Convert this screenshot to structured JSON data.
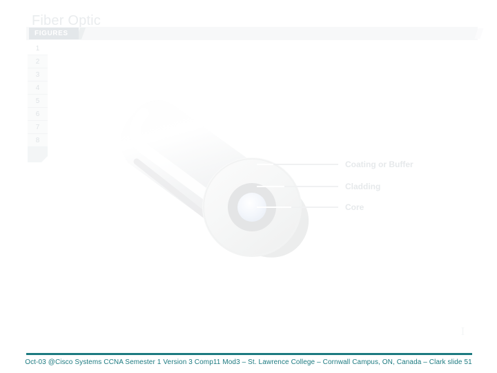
{
  "slide": {
    "title": "Fiber Optic",
    "tab_label": "FIGURES",
    "caret_glyph": "I"
  },
  "figure_rail": {
    "items": [
      "1",
      "2",
      "3",
      "4",
      "5",
      "6",
      "7",
      "8"
    ],
    "blank_item": ""
  },
  "figure": {
    "name": "fiber-optic-cable-cross-section",
    "callouts": [
      {
        "label": "Coating or Buffer"
      },
      {
        "label": "Cladding"
      },
      {
        "label": "Core"
      }
    ]
  },
  "footer": {
    "text": "Oct-03 @Cisco Systems CCNA Semester 1 Version 3 Comp11 Mod3 – St. Lawrence College – Cornwall Campus, ON, Canada – Clark slide 51"
  },
  "colors": {
    "title": "#e9ecee",
    "tab_bg": "#e3e7ea",
    "tab_text": "#ffffff",
    "rail_text": "#dfe3e6",
    "callout_text": "#e6e9eb",
    "footer_accent": "#1c7a80",
    "page_bg": "#ffffff"
  }
}
